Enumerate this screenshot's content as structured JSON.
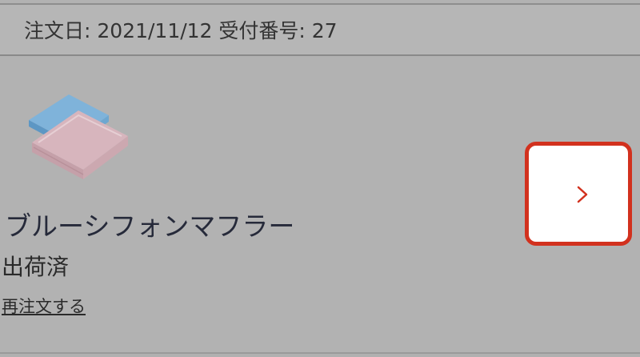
{
  "order": {
    "header": "注文日: 2021/11/12 受付番号: 27",
    "product_name": "ブルーシフォンマフラー",
    "status": "出荷済",
    "reorder_label": "再注文する",
    "detail_icon": "chevron-right-icon",
    "accent_color": "#d2311e"
  }
}
